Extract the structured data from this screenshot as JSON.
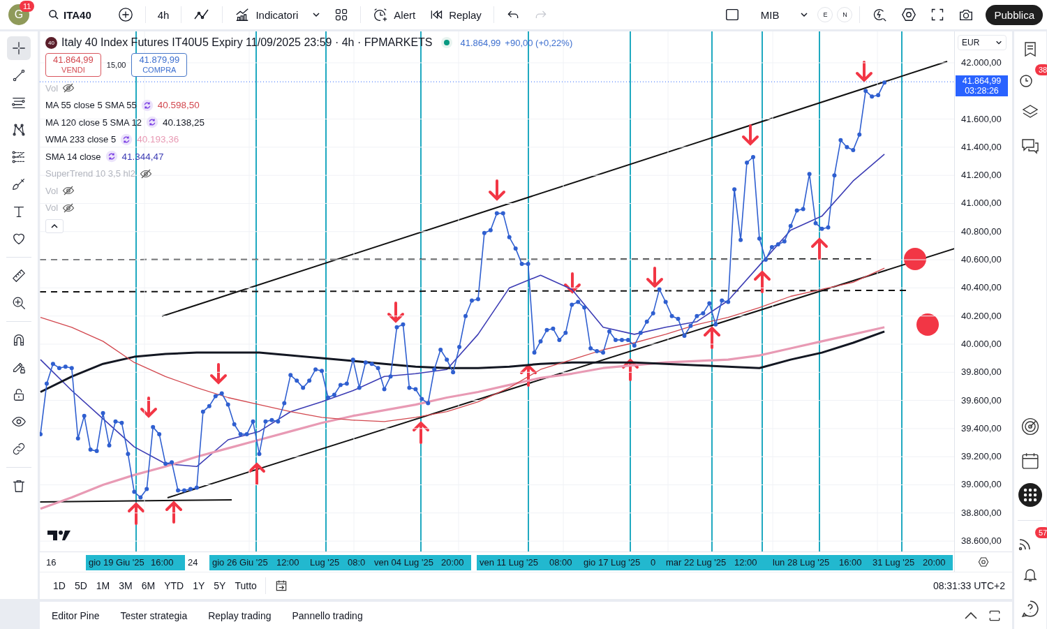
{
  "top_bar": {
    "avatar_letter": "G",
    "avatar_badge": "11",
    "symbol": "ITA40",
    "interval": "4h",
    "indicators_label": "Indicatori",
    "alert_label": "Alert",
    "replay_label": "Replay",
    "redo_disabled": true,
    "layout_name": "MIB",
    "session_badges": [
      "E",
      "N"
    ],
    "publish_label": "Pubblica"
  },
  "left_toolbar": [
    {
      "selected": true
    },
    {
      "selected": false
    },
    {
      "selected": false
    },
    {
      "selected": false
    },
    {
      "selected": false
    },
    {
      "selected": false
    },
    {
      "selected": false
    },
    {
      "selected": false
    },
    {
      "selected": false
    },
    {
      "selected": false
    },
    {
      "selected": false
    },
    {
      "selected": false
    },
    {
      "selected": false
    },
    {
      "selected": false
    },
    {
      "selected": false
    },
    {
      "selected": false
    }
  ],
  "chart": {
    "header": {
      "logo_badge": "40",
      "title": "Italy 40 Index Futures IT40U5 Expiry 11/09/2025 23:59 · 4h · FPMARKETS",
      "market_open": true,
      "last": "41.864,99",
      "change": "+90,00 (+0,22%)"
    },
    "trade": {
      "sell_price": "41.864,99",
      "sell_label": "VENDI",
      "spread": "15,00",
      "buy_price": "41.879,99",
      "buy_label": "COMPRA"
    },
    "legend": [
      {
        "name": "Vol",
        "hidden": true
      },
      {
        "name": "MA 55 close 5 SMA 55",
        "hidden": false,
        "value": "40.598,50"
      },
      {
        "name": "MA 120 close 5 SMA 12",
        "hidden": false,
        "value": "40.138,25"
      },
      {
        "name": "WMA 233 close 5",
        "hidden": false,
        "value": "40.193,36"
      },
      {
        "name": "SMA 14 close",
        "hidden": false,
        "value": "41.344,47"
      },
      {
        "name": "SuperTrend 10 3,5 hl2",
        "hidden": true
      },
      {
        "name": "Vol",
        "hidden": true
      },
      {
        "name": "Vol",
        "hidden": true
      }
    ],
    "price_axis": {
      "currency": "EUR",
      "last_price": "41.864,99",
      "countdown": "03:28:26"
    },
    "time_axis": [
      {
        "text": "16",
        "highlighted": false
      },
      {
        "text": "gio 19 Giu '25",
        "highlighted": true
      },
      {
        "text": "16:00",
        "highlighted": true
      },
      {
        "text": "24",
        "highlighted": false
      },
      {
        "text": "gio 26 Giu '25",
        "highlighted": true
      },
      {
        "text": "12:00",
        "highlighted": true
      },
      {
        "text": "Lug '25",
        "highlighted": true
      },
      {
        "text": "08:0",
        "highlighted": true
      },
      {
        "text": "ven 04 Lug '25",
        "highlighted": true
      },
      {
        "text": "20:00",
        "highlighted": true
      },
      {
        "text": "ven 11 Lug '25",
        "highlighted": true
      },
      {
        "text": "08:00",
        "highlighted": true
      },
      {
        "text": "gio 17 Lug '25",
        "highlighted": true
      },
      {
        "text": "0",
        "highlighted": true
      },
      {
        "text": "mar 22 Lug '25",
        "highlighted": true
      },
      {
        "text": "12:00",
        "highlighted": true
      },
      {
        "text": "lun 28 Lug '25",
        "highlighted": true
      },
      {
        "text": "16:00",
        "highlighted": true
      },
      {
        "text": "31 Lug '25",
        "highlighted": true
      },
      {
        "text": "20:00",
        "highlighted": true
      }
    ],
    "chart_data": {
      "type": "line",
      "grid": true,
      "ref_lines": [
        {
          "axis": "y",
          "value": 41864.99
        }
      ],
      "ylim": [
        38526,
        42223
      ],
      "yticks": [
        {
          "value": 42000,
          "label": "42.000,00"
        },
        {
          "value": 41600,
          "label": "41.600,00"
        },
        {
          "value": 41400,
          "label": "41.400,00"
        },
        {
          "value": 41200,
          "label": "41.200,00"
        },
        {
          "value": 41000,
          "label": "41.000,00"
        },
        {
          "value": 40800,
          "label": "40.800,00"
        },
        {
          "value": 40600,
          "label": "40.600,00"
        },
        {
          "value": 40400,
          "label": "40.400,00"
        },
        {
          "value": 40200,
          "label": "40.200,00"
        },
        {
          "value": 40000,
          "label": "40.000,00"
        },
        {
          "value": 39800,
          "label": "39.800,00"
        },
        {
          "value": 39600,
          "label": "39.600,00"
        },
        {
          "value": 39400,
          "label": "39.400,00"
        },
        {
          "value": 39200,
          "label": "39.200,00"
        },
        {
          "value": 39000,
          "label": "39.000,00"
        },
        {
          "value": 38800,
          "label": "38.800,00"
        },
        {
          "value": 38600,
          "label": "38.600,00"
        }
      ],
      "categories": [
        null,
        null,
        null,
        null,
        null,
        null,
        null,
        null,
        null,
        null,
        null,
        null,
        null,
        null,
        null,
        null,
        null,
        null,
        null,
        null,
        null,
        null,
        null,
        null,
        null,
        null,
        null,
        null,
        null,
        null,
        null,
        null,
        null,
        null,
        null,
        null,
        null,
        null,
        null,
        null,
        null,
        null,
        null,
        null,
        null,
        null,
        null,
        null,
        null,
        null,
        null,
        null,
        null,
        null,
        null,
        null,
        null,
        null,
        null,
        null,
        null,
        null,
        null,
        null,
        null,
        null,
        null,
        null,
        null,
        null,
        null,
        null,
        null,
        null,
        null,
        null,
        null,
        null,
        null,
        null,
        null,
        null,
        null,
        null,
        null,
        null,
        null,
        null,
        null,
        null,
        null,
        null,
        null,
        null,
        null,
        null,
        null,
        null,
        null,
        null,
        null,
        null,
        null,
        null,
        null,
        null,
        null,
        null,
        null,
        null,
        null,
        null,
        null,
        null,
        null,
        null,
        null,
        null,
        null,
        null,
        null,
        null,
        null,
        null,
        null,
        null,
        null,
        null,
        null,
        null,
        null,
        null,
        null,
        null,
        null,
        null
      ],
      "series": [
        {
          "color": "#2f5fd0",
          "marker": "circle",
          "values": [
            39360,
            39720,
            39860,
            39830,
            39840,
            39830,
            39330,
            39490,
            39250,
            39240,
            39510,
            39280,
            39450,
            39440,
            39220,
            38950,
            38910,
            38970,
            39410,
            39360,
            39150,
            39160,
            38960,
            38960,
            38970,
            38980,
            39520,
            39560,
            39630,
            39650,
            39570,
            39430,
            39360,
            39360,
            39450,
            39220,
            39450,
            39460,
            39450,
            39580,
            39780,
            39740,
            39690,
            39740,
            39820,
            39810,
            39620,
            39640,
            39710,
            39720,
            39890,
            39690,
            39870,
            39860,
            39830,
            39680,
            39770,
            40120,
            40140,
            39690,
            39680,
            39610,
            39580,
            39820,
            39960,
            39890,
            39800,
            39980,
            40200,
            40310,
            40320,
            40790,
            40810,
            40930,
            40930,
            40760,
            40680,
            40570,
            40570,
            39940,
            40020,
            40100,
            40110,
            40030,
            40080,
            40280,
            40300,
            40260,
            39970,
            39950,
            39940,
            40090,
            40030,
            40030,
            40030,
            39990,
            40080,
            40160,
            40220,
            40390,
            40300,
            40200,
            40180,
            40060,
            40130,
            40200,
            40220,
            40290,
            40140,
            40310,
            40300,
            41100,
            40740,
            41290,
            41330,
            40750,
            40600,
            40690,
            40710,
            40730,
            40840,
            40950,
            40960,
            41210,
            40860,
            40820,
            40830,
            41200,
            41450,
            41400,
            41380,
            41490,
            41800,
            41760,
            41770,
            41860
          ]
        },
        {
          "color": "#d2474e",
          "values": [
            40190,
            null,
            null,
            null,
            null,
            40120,
            null,
            null,
            null,
            null,
            40020,
            null,
            null,
            null,
            null,
            39870,
            null,
            null,
            null,
            null,
            39770,
            null,
            null,
            null,
            null,
            39690,
            null,
            null,
            null,
            null,
            39620,
            null,
            null,
            null,
            null,
            39570,
            null,
            null,
            null,
            null,
            39520,
            null,
            null,
            null,
            null,
            39480,
            null,
            null,
            null,
            null,
            39460,
            null,
            null,
            null,
            null,
            39450,
            null,
            null,
            null,
            null,
            39480,
            null,
            null,
            null,
            null,
            39520,
            null,
            null,
            null,
            null,
            39590,
            null,
            null,
            null,
            null,
            39690,
            null,
            null,
            null,
            null,
            39820,
            null,
            null,
            null,
            null,
            39890,
            null,
            null,
            null,
            null,
            39960,
            null,
            null,
            null,
            null,
            40010,
            null,
            null,
            null,
            null,
            40070,
            null,
            null,
            null,
            null,
            40140,
            null,
            null,
            null,
            null,
            40190,
            null,
            null,
            null,
            null,
            40260,
            null,
            null,
            null,
            null,
            40340,
            null,
            null,
            null,
            null,
            40390,
            null,
            null,
            null,
            null,
            40440,
            null,
            null,
            null,
            null,
            40540
          ]
        },
        {
          "color": "#131722",
          "values": [
            39660,
            null,
            null,
            null,
            null,
            39770,
            null,
            null,
            null,
            null,
            39860,
            null,
            null,
            null,
            null,
            39910,
            null,
            null,
            null,
            null,
            39930,
            null,
            null,
            null,
            null,
            39940,
            null,
            null,
            null,
            null,
            39940,
            null,
            null,
            null,
            null,
            39940,
            null,
            null,
            null,
            null,
            39920,
            null,
            null,
            null,
            null,
            39900,
            null,
            null,
            null,
            null,
            39880,
            null,
            null,
            null,
            null,
            39860,
            null,
            null,
            null,
            null,
            39840,
            null,
            null,
            null,
            null,
            39830,
            null,
            null,
            null,
            null,
            39830,
            null,
            null,
            null,
            null,
            39840,
            null,
            null,
            null,
            null,
            39860,
            null,
            null,
            null,
            null,
            39870,
            null,
            null,
            null,
            null,
            39870,
            null,
            null,
            null,
            null,
            39870,
            null,
            null,
            null,
            null,
            39860,
            null,
            null,
            null,
            null,
            39850,
            null,
            null,
            null,
            null,
            39840,
            null,
            null,
            null,
            null,
            39830,
            null,
            null,
            null,
            null,
            39890,
            null,
            null,
            null,
            null,
            39940,
            null,
            null,
            null,
            null,
            40010,
            null,
            null,
            null,
            null,
            40090
          ]
        },
        {
          "color": "#e89ab4",
          "values": [
            38830,
            null,
            null,
            null,
            null,
            38910,
            null,
            null,
            null,
            null,
            39000,
            null,
            null,
            null,
            null,
            39070,
            null,
            null,
            null,
            null,
            39130,
            null,
            null,
            null,
            null,
            39200,
            null,
            null,
            null,
            null,
            39260,
            null,
            null,
            null,
            null,
            39320,
            null,
            null,
            null,
            null,
            39380,
            null,
            null,
            null,
            null,
            39440,
            null,
            null,
            null,
            null,
            39490,
            null,
            null,
            null,
            null,
            39530,
            null,
            null,
            null,
            null,
            39570,
            null,
            null,
            null,
            null,
            39620,
            null,
            null,
            null,
            null,
            39660,
            null,
            null,
            null,
            null,
            39710,
            null,
            null,
            null,
            null,
            39760,
            null,
            null,
            null,
            null,
            39790,
            null,
            null,
            null,
            null,
            39830,
            null,
            null,
            null,
            null,
            39850,
            null,
            null,
            null,
            null,
            39870,
            null,
            null,
            null,
            null,
            39880,
            null,
            null,
            null,
            null,
            39890,
            null,
            null,
            null,
            null,
            39920,
            null,
            null,
            null,
            null,
            39970,
            null,
            null,
            null,
            null,
            40020,
            null,
            null,
            null,
            null,
            40070,
            null,
            null,
            null,
            null,
            40120
          ]
        },
        {
          "color": "#3c3cb4",
          "values": [
            39890,
            null,
            null,
            null,
            null,
            39670,
            null,
            null,
            null,
            null,
            39470,
            null,
            null,
            null,
            null,
            39270,
            null,
            null,
            null,
            null,
            39150,
            null,
            null,
            null,
            null,
            39130,
            null,
            null,
            null,
            null,
            39320,
            null,
            null,
            null,
            null,
            39380,
            null,
            null,
            null,
            null,
            39520,
            null,
            null,
            null,
            null,
            39590,
            null,
            null,
            null,
            null,
            39670,
            null,
            null,
            null,
            null,
            39770,
            null,
            null,
            null,
            null,
            39790,
            null,
            null,
            null,
            null,
            39820,
            null,
            null,
            null,
            null,
            40070,
            null,
            null,
            null,
            null,
            40400,
            null,
            null,
            null,
            null,
            40490,
            null,
            null,
            null,
            null,
            40390,
            null,
            null,
            null,
            null,
            40120,
            null,
            null,
            null,
            null,
            40070,
            null,
            null,
            null,
            null,
            40120,
            null,
            null,
            null,
            null,
            40160,
            null,
            null,
            null,
            null,
            40310,
            null,
            null,
            null,
            null,
            40560,
            null,
            null,
            null,
            null,
            40810,
            null,
            null,
            null,
            null,
            40910,
            null,
            null,
            null,
            null,
            41160,
            null,
            null,
            null,
            null,
            41350
          ]
        }
      ]
    }
  },
  "range_buttons": [
    "1D",
    "5D",
    "1M",
    "3M",
    "6M",
    "YTD",
    "1Y",
    "5Y",
    "Tutto"
  ],
  "clock": "08:31:33 UTC+2",
  "bottom_tabs": [
    {
      "label": "Editor Pine",
      "selected": false
    },
    {
      "label": "Tester strategia",
      "selected": false
    },
    {
      "label": "Replay trading",
      "selected": false
    },
    {
      "label": "Pannello trading",
      "selected": false
    }
  ],
  "right_sidebar": {
    "alerts_badge": "38",
    "feed_badge": "57"
  }
}
